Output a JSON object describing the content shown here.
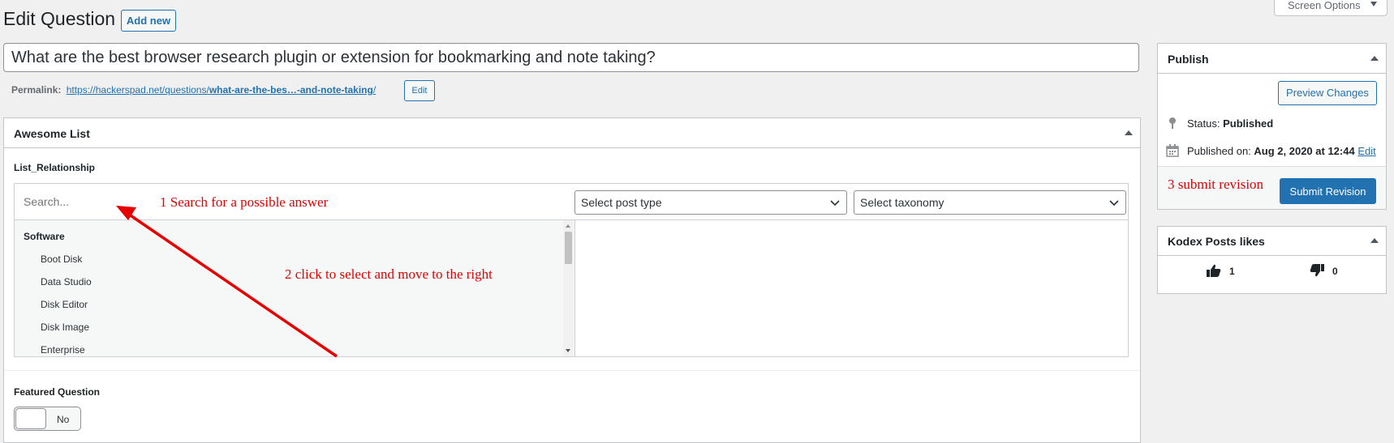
{
  "header": {
    "title": "Edit Question",
    "add_new": "Add new",
    "screen_options": "Screen Options"
  },
  "post": {
    "title": "What are the best browser research plugin or extension for bookmarking and note taking?",
    "permalink_label": "Permalink:",
    "permalink_base": "https://hackerspad.net/questions/",
    "permalink_slug": "what-are-the-bes…-and-note-taking",
    "permalink_end": "/",
    "permalink_edit": "Edit"
  },
  "awesome_list": {
    "title": "Awesome List",
    "field_label": "List_Relationship",
    "search_placeholder": "Search...",
    "select_post_type": "Select post type",
    "select_taxonomy": "Select taxonomy",
    "group": "Software",
    "items": [
      "Boot Disk",
      "Data Studio",
      "Disk Editor",
      "Disk Image",
      "Enterprise"
    ]
  },
  "annotations": {
    "step1": "1 Search for a possible answer",
    "step2": "2 click to select and move to the right",
    "step3": "3 submit revision",
    "color": "#e60000"
  },
  "featured": {
    "label": "Featured Question",
    "toggle_value": "No"
  },
  "publish": {
    "title": "Publish",
    "preview": "Preview Changes",
    "status_label": "Status:",
    "status_value": "Published",
    "published_label": "Published on:",
    "published_value": "Aug 2, 2020 at 12:44",
    "published_edit": "Edit",
    "submit": "Submit Revision"
  },
  "likes": {
    "title": "Kodex Posts likes",
    "likes": "1",
    "dislikes": "0"
  },
  "colors": {
    "accent": "#2271b1",
    "background": "#f0f0f1",
    "annotation": "#e60000"
  }
}
